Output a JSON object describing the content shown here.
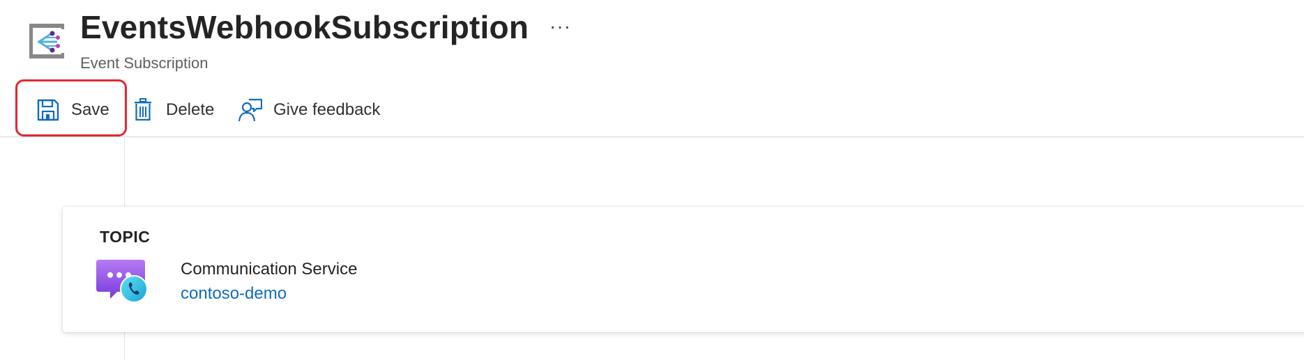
{
  "header": {
    "title": "EventsWebhookSubscription",
    "more_label": "···",
    "subtitle": "Event Subscription",
    "icon": "event-subscription-icon"
  },
  "toolbar": {
    "save_label": "Save",
    "delete_label": "Delete",
    "feedback_label": "Give feedback",
    "highlight_color": "#e4262d"
  },
  "topic": {
    "section_label": "TOPIC",
    "type": "Communication Service",
    "name": "contoso-demo",
    "icon": "communication-service-icon",
    "link_color": "#0f6cbd"
  }
}
